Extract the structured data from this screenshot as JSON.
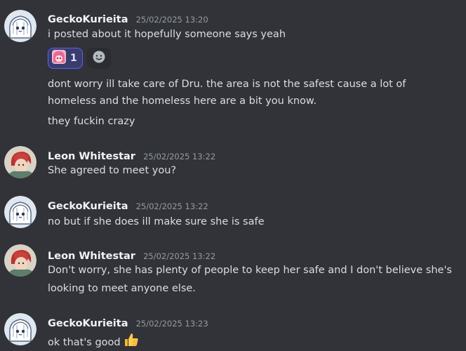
{
  "messages": [
    {
      "author": "GeckoKurieita",
      "timestamp": "25/02/2025 13:20",
      "lines": [
        "i posted about it hopefully someone says yeah",
        "dont worry ill take care of Dru. the area is not the safest cause a lot of",
        "homeless and the homeless here are a bit you know.",
        "they fuckin crazy"
      ],
      "reaction": {
        "emoji": "anime-girl-emoji",
        "count": "1"
      },
      "add_reaction_icon": "add-reaction-smiley-icon"
    },
    {
      "author": "Leon Whitestar",
      "timestamp": "25/02/2025 13:22",
      "lines": [
        "She agreed to meet you?"
      ]
    },
    {
      "author": "GeckoKurieita",
      "timestamp": "25/02/2025 13:22",
      "lines": [
        "no but if she does ill make sure she is safe"
      ]
    },
    {
      "author": "Leon Whitestar",
      "timestamp": "25/02/2025 13:22",
      "lines": [
        "Don't worry, she has plenty of people to keep her safe and I don't believe she's",
        "looking to meet anyone else."
      ]
    },
    {
      "author": "GeckoKurieita",
      "timestamp": "25/02/2025 13:23",
      "lines": [
        "ok that's good"
      ],
      "trailing_emoji": "thumbs-up-emoji"
    }
  ],
  "colors": {
    "background": "#313338",
    "username": "#f2f3f5",
    "timestamp": "#949ba4",
    "message_text": "#dbdee1",
    "reaction_border": "#5865f2"
  }
}
